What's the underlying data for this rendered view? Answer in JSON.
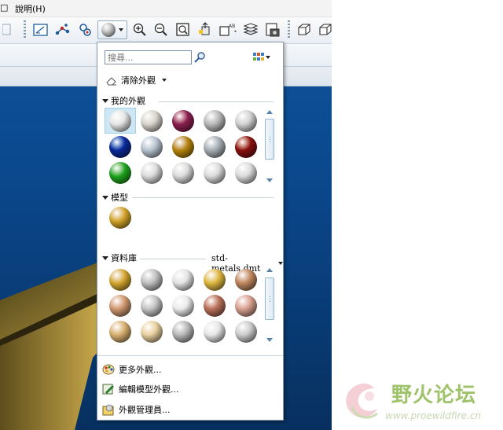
{
  "menubar": {
    "items": [
      "□",
      "說明(H)"
    ]
  },
  "toolbar": {
    "icons": [
      "copy-icon",
      "sketch-view-icon",
      "spline-icon",
      "regenerate-icon",
      "appearance-gallery-icon",
      "zoom-in-icon",
      "zoom-out-icon",
      "refit-icon",
      "reorient-icon",
      "saved-views-icon",
      "layers-icon",
      "display-style-icon",
      "wireframe-icon",
      "hidden-line-icon"
    ]
  },
  "popup": {
    "search": {
      "placeholder": "搜尋..."
    },
    "clear_appearance": {
      "label": "清除外觀"
    },
    "my_appearances": {
      "header": "我的外觀",
      "swatches": [
        "#e6e6e6",
        "#d8d4cc",
        "#8c1f50",
        "#b9b9b9",
        "#d2d2d2",
        "#0a2a9a",
        "#b8c4d0",
        "#b8860b",
        "#a8b0b6",
        "#8a1010",
        "#1ea51e",
        "#dcdcdc",
        "#dcdcdc",
        "#dcdcdc",
        "#dcdcdc"
      ],
      "selected_index": 0
    },
    "model": {
      "header": "模型",
      "swatches": [
        "#d4a62a"
      ]
    },
    "library": {
      "header": "資料庫",
      "file": "std-metals.dmt",
      "swatches": [
        "#d6a830",
        "#c0c0c0",
        "#e4e4e4",
        "#e0b840",
        "#c08860",
        "#d09870",
        "#c4c4c4",
        "#eaeaea",
        "#b87058",
        "#d8a090",
        "#d8b070",
        "#e8d0a0",
        "#b8b8b8",
        "#e6e6e6",
        "#cccccc"
      ]
    },
    "actions": [
      {
        "label": "更多外觀...",
        "icon": "palette-icon"
      },
      {
        "label": "編輯模型外觀...",
        "icon": "edit-appearance-icon"
      },
      {
        "label": "外觀管理員...",
        "icon": "appearance-manager-icon"
      }
    ]
  },
  "watermark": {
    "title": "野火论坛",
    "url": "www.proewildfire.cn"
  }
}
